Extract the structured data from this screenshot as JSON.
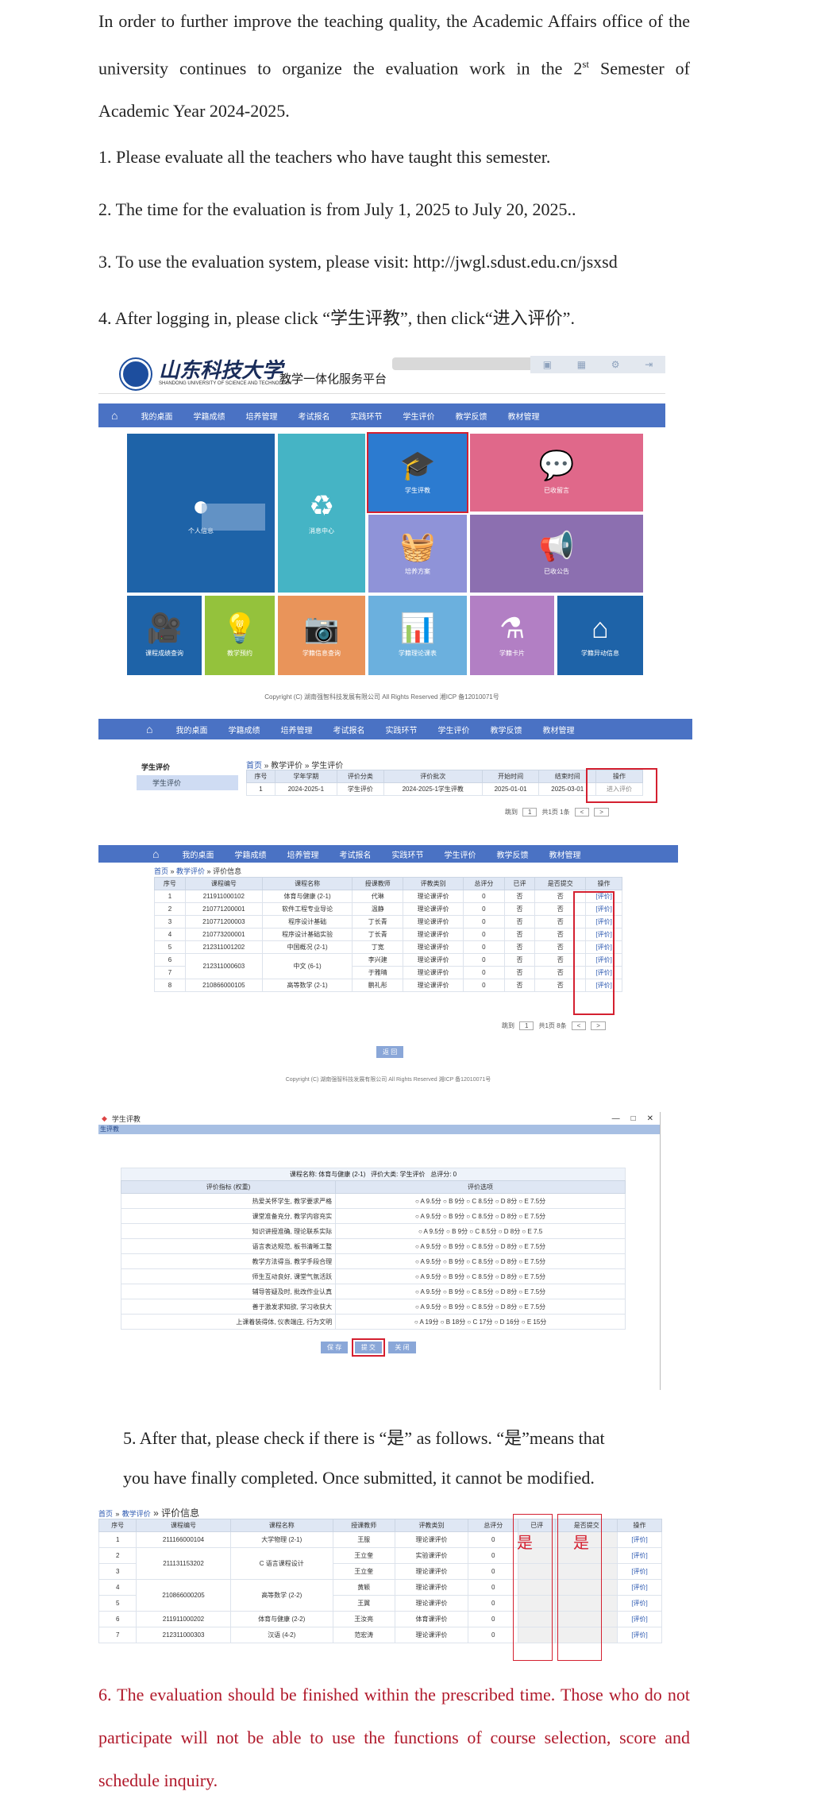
{
  "intro": {
    "part1": "In order to further improve the teaching quality, the Academic Affairs office of the university continues to organize the evaluation work in the 2",
    "sup": "st",
    "part2": " Semester of Academic Year 2024-2025."
  },
  "items": [
    "1.  Please evaluate all the teachers who have taught this semester.",
    "2. The time for the evaluation is from July 1, 2025 to July 20, 2025..",
    "3. To use the evaluation system, please visit: http://jwgl.sdust.edu.cn/jsxsd",
    "4. After logging in, please click “学生评教”, then click“进入评价”."
  ],
  "portal": {
    "logo_cn": "山东科技大学",
    "logo_en": "SHANDONG UNIVERSITY OF SCIENCE AND TECHNOLOGY",
    "subtitle": "教学一体化服务平台",
    "nav": [
      "⌂",
      "我的桌面",
      "学籍成绩",
      "培养管理",
      "考试报名",
      "实践环节",
      "学生评价",
      "教学反馈",
      "教材管理"
    ],
    "tiles": {
      "personal": "个人信息",
      "message": "消息中心",
      "eval": "学生评教",
      "reply": "已收留言",
      "training": "培养方案",
      "notice": "已收公告",
      "video": "课程成绩查询",
      "plan": "教学预约",
      "exam": "学籍信息查询",
      "grade": "学籍理论课表",
      "lab": "学籍卡片",
      "board": "学籍异动信息"
    },
    "copyright": "Copyright (C) 湖南强智科技发展有限公司 All Rights Reserved 湘ICP 备12010071号"
  },
  "p2": {
    "nav": [
      "⌂",
      "我的桌面",
      "学籍成绩",
      "培养管理",
      "考试报名",
      "实践环节",
      "学生评价",
      "教学反馈",
      "教材管理"
    ],
    "side_title": "学生评价",
    "side_item": "学生评价",
    "bc_home": "首页",
    "bc_rest": " » 教学评价 » 学生评价",
    "headers": [
      "序号",
      "学年学期",
      "评价分类",
      "评价批次",
      "开始时间",
      "结束时间",
      "操作"
    ],
    "row": [
      "1",
      "2024-2025-1",
      "学生评价",
      "2024-2025-1学生评教",
      "2025-01-01",
      "2025-03-01",
      "进入评价"
    ],
    "pager": [
      "跳到",
      "1",
      "共1页 1条",
      "<",
      ">"
    ]
  },
  "p3": {
    "nav": [
      "⌂",
      "我的桌面",
      "学籍成绩",
      "培养管理",
      "考试报名",
      "实践环节",
      "学生评价",
      "教学反馈",
      "教材管理"
    ],
    "bc_home": "首页",
    "bc_mid": "教学评价",
    "bc_rest": "评价信息",
    "headers": [
      "序号",
      "课程编号",
      "课程名称",
      "授课教师",
      "评教类别",
      "总评分",
      "已评",
      "是否提交",
      "操作"
    ],
    "rows": [
      [
        "1",
        "211911000102",
        "体育与健康 (2-1)",
        "代琳",
        "理论课评价",
        "0",
        "否",
        "否",
        "[评价]"
      ],
      [
        "2",
        "210771200001",
        "软件工程专业导论",
        "温静",
        "理论课评价",
        "0",
        "否",
        "否",
        "[评价]"
      ],
      [
        "3",
        "210771200003",
        "程序设计基础",
        "丁长青",
        "理论课评价",
        "0",
        "否",
        "否",
        "[评价]"
      ],
      [
        "4",
        "210773200001",
        "程序设计基础实验",
        "丁长青",
        "理论课评价",
        "0",
        "否",
        "否",
        "[评价]"
      ],
      [
        "5",
        "212311001202",
        "中国概况 (2-1)",
        "丁宽",
        "理论课评价",
        "0",
        "否",
        "否",
        "[评价]"
      ],
      [
        "6",
        "212311000603",
        "中文 (6-1)",
        "李兴建",
        "理论课评价",
        "0",
        "否",
        "否",
        "[评价]"
      ],
      [
        "7",
        "",
        "",
        "于雅晴",
        "理论课评价",
        "0",
        "否",
        "否",
        "[评价]"
      ],
      [
        "8",
        "210866000105",
        "高等数学 (2-1)",
        "鹏礼彤",
        "理论课评价",
        "0",
        "否",
        "否",
        "[评价]"
      ]
    ],
    "pager": [
      "跳到",
      "1",
      "共1页 8条",
      "<",
      ">"
    ],
    "back": "返 回",
    "copyright": "Copyright (C) 湖南强智科技发展有限公司 All Rights Reserved 湘ICP 备12010071号"
  },
  "p4": {
    "window_title": "学生评教",
    "bar": "生评教",
    "course": "课程名称: 体育与健康 (2-1)",
    "category": "评价大类: 学生评价",
    "total": "总评分: 0",
    "col1": "评价指标 (权重)",
    "col2": "评价选项",
    "rows": [
      [
        "热爱关怀学生, 教学要求严格",
        "○ A 9.5分 ○ B 9分 ○ C 8.5分 ○ D 8分 ○ E 7.5分"
      ],
      [
        "课堂准备充分, 教学内容充实",
        "○ A 9.5分 ○ B 9分 ○ C 8.5分 ○ D 8分 ○ E 7.5分"
      ],
      [
        "知识讲授准确, 理论联系实际",
        "○ A 9.5分 ○ B 9分 ○ C 8.5分 ○ D 8分 ○ E 7.5"
      ],
      [
        "语言表达规范, 板书清晰工整",
        "○ A 9.5分 ○ B 9分 ○ C 8.5分 ○ D 8分 ○ E 7.5分"
      ],
      [
        "教学方法得当, 教学手段合理",
        "○ A 9.5分 ○ B 9分 ○ C 8.5分 ○ D 8分 ○ E 7.5分"
      ],
      [
        "师生互动良好, 课堂气氛活跃",
        "○ A 9.5分 ○ B 9分 ○ C 8.5分 ○ D 8分 ○ E 7.5分"
      ],
      [
        "辅导答疑及时, 批改作业认真",
        "○ A 9.5分 ○ B 9分 ○ C 8.5分 ○ D 8分 ○ E 7.5分"
      ],
      [
        "善于激发求知欲, 学习收获大",
        "○ A 9.5分 ○ B 9分 ○ C 8.5分 ○ D 8分 ○ E 7.5分"
      ],
      [
        "上课着装得体, 仪表端庄, 行为文明",
        "○ A 19分 ○ B 18分 ○ C 17分 ○ D 16分 ○ E 15分"
      ]
    ],
    "buttons": [
      "保 存",
      "提 交",
      "关 闭"
    ]
  },
  "step5": {
    "line1": "5. After that, please check if there is “是”  as follows.  “是”means that",
    "line2": "you have finally completed. Once submitted, it cannot be modified."
  },
  "p5": {
    "bc_home": "首页",
    "bc_mid": "教学评价",
    "bc_rest": "评价信息",
    "headers": [
      "序号",
      "课程编号",
      "课程名称",
      "授课教师",
      "评教类别",
      "总评分",
      "已评",
      "是否提交",
      "操作"
    ],
    "rows": [
      [
        "1",
        "211166000104",
        "大学物理 (2-1)",
        "王服",
        "理论课评价",
        "0",
        "[评价]"
      ],
      [
        "2",
        "211131153202",
        "C 语言课程设计",
        "王立奎",
        "实验课评价",
        "0",
        "[评价]"
      ],
      [
        "3",
        "",
        "",
        "王立奎",
        "理论课评价",
        "0",
        "[评价]"
      ],
      [
        "4",
        "210866000205",
        "高等数学 (2-2)",
        "黄颖",
        "理论课评价",
        "0",
        "[评价]"
      ],
      [
        "5",
        "",
        "",
        "王翼",
        "理论课评价",
        "0",
        "[评价]"
      ],
      [
        "6",
        "211911000202",
        "体育与健康 (2-2)",
        "王汝亮",
        "体育课评价",
        "0",
        "[评价]"
      ],
      [
        "7",
        "212311000303",
        "汉语 (4-2)",
        "范宏涛",
        "理论课评价",
        "0",
        "[评价]"
      ]
    ],
    "yes": "是"
  },
  "step6": "6. The evaluation should be finished within the prescribed time. Those who do not participate will not be able to use the functions of course selection, score and schedule inquiry.",
  "colors": {
    "nav": "#4a72c4",
    "red": "#b0182a",
    "box": "#d42030"
  }
}
